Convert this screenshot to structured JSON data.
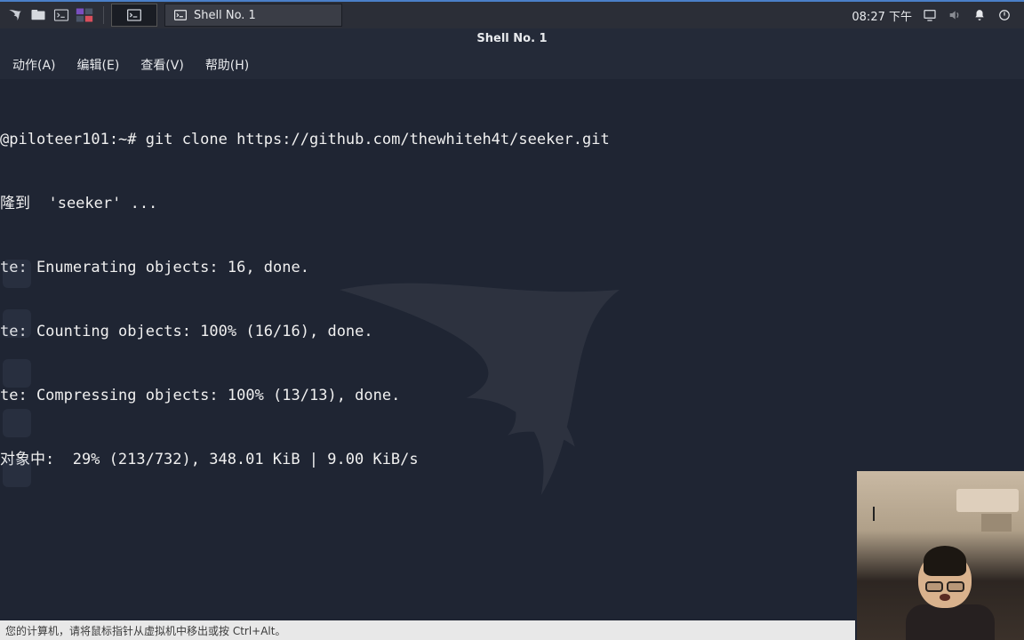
{
  "taskbar": {
    "active_window_label": "Shell No. 1",
    "clock": "08:27 下午"
  },
  "terminal": {
    "title": "Shell No. 1",
    "menu": {
      "actions": "动作(A)",
      "edit": "编辑(E)",
      "view": "查看(V)",
      "help": "帮助(H)"
    },
    "lines": [
      "@piloteer101:~# git clone https://github.com/thewhiteh4t/seeker.git",
      "隆到  'seeker' ...",
      "te: Enumerating objects: 16, done.",
      "te: Counting objects: 100% (16/16), done.",
      "te: Compressing objects: 100% (13/13), done.",
      "对象中:  29% (213/732), 348.01 KiB | 9.00 KiB/s"
    ]
  },
  "vm_hint": "您的计算机，请将鼠标指针从虚拟机中移出或按 Ctrl+Alt。"
}
